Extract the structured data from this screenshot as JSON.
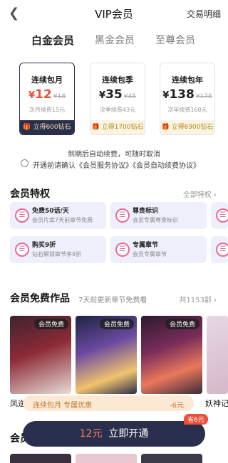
{
  "header": {
    "back_icon": "chevron-left-icon",
    "title": "VIP会员",
    "right_link": "交易明细"
  },
  "tiers": [
    {
      "label": "白金会员",
      "active": true
    },
    {
      "label": "黑金会员",
      "active": false
    },
    {
      "label": "至尊会员",
      "active": false
    }
  ],
  "plans": [
    {
      "name": "连续包月",
      "currency": "¥",
      "price": "12",
      "original": "¥18",
      "renew": "次月续费15元",
      "gift": "立得600钻石",
      "selected": true
    },
    {
      "name": "连续包季",
      "currency": "¥",
      "price": "35",
      "original": "¥45",
      "renew": "次季续费43元",
      "gift": "立得1700钻石",
      "selected": false
    },
    {
      "name": "连续包年",
      "currency": "¥",
      "price": "138",
      "original": "¥178",
      "renew": "次年续费168元",
      "gift": "立得6900钻石",
      "selected": false
    }
  ],
  "auto_note": "到期后自动续费，可随时取消",
  "agreement": "开通前请确认《会员服务协议》《会员自动续费协议》",
  "privileges": {
    "title": "会员特权",
    "more": "全部特权",
    "items": [
      {
        "title": "免费50话/天",
        "desc": "会员片库7天前章节免费"
      },
      {
        "title": "尊贵标识",
        "desc": "会员专属尊贵标识"
      },
      {
        "title": "购买9折",
        "desc": "钻石解锁章节享9折"
      },
      {
        "title": "专属章节",
        "desc": "会员专属章节"
      }
    ]
  },
  "free_works": {
    "title": "会员免费作品",
    "subtitle": "7天前更新章节免费看",
    "more": "共1153部",
    "badge": "会员免费",
    "titles": [
      "凤逆",
      "",
      "",
      "妖神记"
    ]
  },
  "promo": {
    "text": "连续包月 专属优惠",
    "amount": "-6元"
  },
  "cta": {
    "price": "12元",
    "label": "立即开通",
    "save_tag": "省6元"
  },
  "peek_section": "会员",
  "colors": {
    "accent": "#e8503a",
    "navy": "#2a2f4d",
    "gold": "#b8860b"
  }
}
